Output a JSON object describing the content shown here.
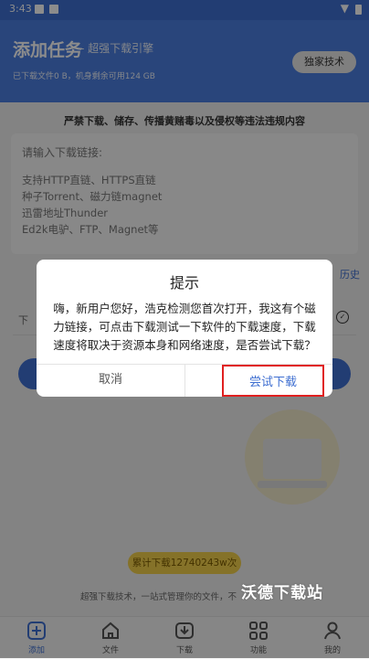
{
  "status_bar": {
    "time": "3:43"
  },
  "header": {
    "title": "添加任务",
    "subtitle": "- 超强下载引擎",
    "storage_info": "已下载文件0 B，机身剩余可用124 GB",
    "tech_button": "独家技术"
  },
  "notice": "严禁下载、储存、传播黄赌毒以及侵权等违法违规内容",
  "link_input": {
    "placeholder": "请输入下载链接:",
    "supported": [
      "支持HTTP直链、HTTPS直链",
      "种子Torrent、磁力链magnet",
      "迅雷地址Thunder",
      "Ed2k电驴、FTP、Magnet等"
    ]
  },
  "history_link": "历史",
  "row_partial": "下",
  "total_downloads": "累计下载12740243w次",
  "slogan": "超强下载技术，一站式管理你的文件，不",
  "watermark": "沃德下载站",
  "tabs": [
    {
      "label": "添加",
      "icon": "add-icon",
      "active": true
    },
    {
      "label": "文件",
      "icon": "home-icon",
      "active": false
    },
    {
      "label": "下载",
      "icon": "download-icon",
      "active": false
    },
    {
      "label": "功能",
      "icon": "grid-icon",
      "active": false
    },
    {
      "label": "我的",
      "icon": "user-icon",
      "active": false
    }
  ],
  "dialog": {
    "title": "提示",
    "message": "嗨，新用户您好，浩克检测您首次打开，我这有个磁力链接，可点击下载测试一下软件的下载速度，下载速度将取决于资源本身和网络速度，是否尝试下载？",
    "cancel": "取消",
    "confirm": "尝试下载"
  },
  "colors": {
    "primary": "#3f6fd1",
    "highlight_border": "#e02020",
    "pill": "#f2cf4c"
  }
}
